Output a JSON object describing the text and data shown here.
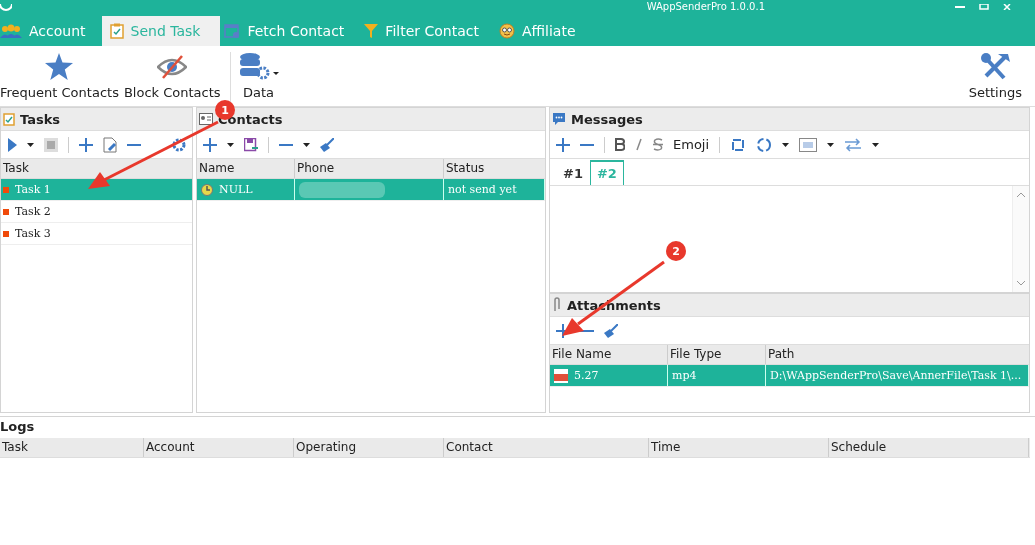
{
  "window": {
    "title": "WAppSenderPro  1.0.0.1"
  },
  "tabs": [
    {
      "label": "Account",
      "selected": false
    },
    {
      "label": "Send Task",
      "selected": true
    },
    {
      "label": "Fetch Contact",
      "selected": false
    },
    {
      "label": "Filter Contact",
      "selected": false
    },
    {
      "label": "Affiliate",
      "selected": false
    }
  ],
  "ribbon": {
    "buttons": [
      {
        "label": "Frequent Contacts",
        "kind": "star"
      },
      {
        "label": "Block Contacts",
        "kind": "block"
      },
      {
        "label": "Data",
        "kind": "data"
      }
    ],
    "settings": "Settings"
  },
  "tasks": {
    "title": "Tasks",
    "column": "Task",
    "rows": [
      {
        "name": "Task 1",
        "selected": true
      },
      {
        "name": "Task 2",
        "selected": false
      },
      {
        "name": "Task 3",
        "selected": false
      }
    ]
  },
  "contacts": {
    "title": "Contacts",
    "columns": [
      "Name",
      "Phone",
      "Status"
    ],
    "rows": [
      {
        "name": "NULL",
        "status": "not send yet",
        "selected": true
      }
    ]
  },
  "messages": {
    "title": "Messages",
    "emoji": "Emoji",
    "tabs": [
      {
        "label": "#1",
        "selected": false
      },
      {
        "label": "#2",
        "selected": true
      }
    ]
  },
  "attachments": {
    "title": "Attachments",
    "columns": [
      "File Name",
      "File Type",
      "Path"
    ],
    "rows": [
      {
        "file_name": "5.27",
        "file_type": "mp4",
        "path": "D:\\WAppSenderPro\\Save\\AnnerFile\\Task 1\\...",
        "selected": true
      }
    ]
  },
  "logs": {
    "title": "Logs",
    "columns": [
      "Task",
      "Account",
      "Operating",
      "Contact",
      "Time",
      "Schedule"
    ]
  },
  "annotations": [
    {
      "label": "1"
    },
    {
      "label": "2"
    }
  ]
}
